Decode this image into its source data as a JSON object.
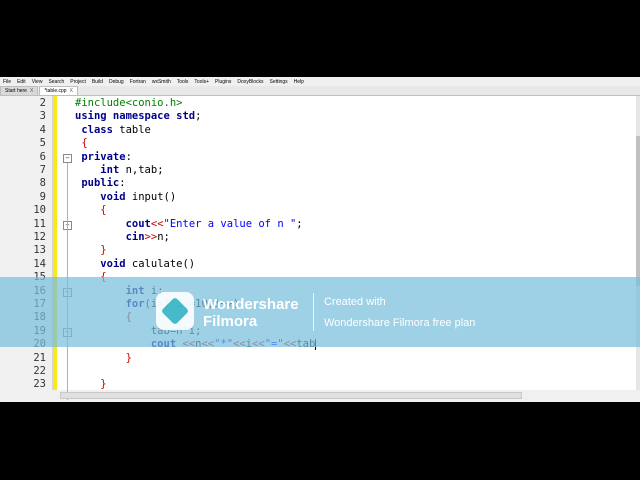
{
  "menubar": [
    "File",
    "Edit",
    "View",
    "Search",
    "Project",
    "Build",
    "Debug",
    "Fortran",
    "wxSmith",
    "Tools",
    "Tools+",
    "Plugins",
    "DoxyBlocks",
    "Settings",
    "Help"
  ],
  "tabs": [
    {
      "label": "Start here",
      "close": "X",
      "active": false
    },
    {
      "label": "*table.cpp",
      "close": "X",
      "active": true
    }
  ],
  "lines": [
    {
      "num": "2",
      "html": "<span class='pp'>#include&lt;conio.h&gt;</span>"
    },
    {
      "num": "3",
      "html": "<span class='kw'>using namespace std</span>;"
    },
    {
      "num": "4",
      "html": " <span class='kw'>class</span> table"
    },
    {
      "num": "5",
      "html": " <span class='op'>{</span>"
    },
    {
      "num": "6",
      "html": " <span class='kw'>private</span>:"
    },
    {
      "num": "7",
      "html": "    <span class='kw'>int</span> n,tab;"
    },
    {
      "num": "8",
      "html": " <span class='kw'>public</span>:"
    },
    {
      "num": "9",
      "html": "    <span class='kw'>void</span> input()"
    },
    {
      "num": "10",
      "html": "    <span class='op'>{</span>"
    },
    {
      "num": "11",
      "html": "        <span class='kw'>cout</span><span class='op'>&lt;&lt;</span><span class='str'>\"Enter a value of n \"</span>;"
    },
    {
      "num": "12",
      "html": "        <span class='kw'>cin</span><span class='op'>&gt;&gt;</span>n;"
    },
    {
      "num": "13",
      "html": "    <span class='op'>}</span>"
    },
    {
      "num": "14",
      "html": "    <span class='kw'>void</span> calulate()"
    },
    {
      "num": "15",
      "html": "    <span class='op'>{</span>"
    },
    {
      "num": "16",
      "html": "        <span class='kw'>int</span> i;"
    },
    {
      "num": "17",
      "html": "        <span class='kw'>for</span>(i=1;i&lt;=10;i++)"
    },
    {
      "num": "18",
      "html": "        <span class='op'>{</span>"
    },
    {
      "num": "19",
      "html": "            tab=n*i;"
    },
    {
      "num": "20",
      "html": "            <span class='kw'>cout</span> <span class='op'>&lt;&lt;</span>n<span class='op'>&lt;&lt;</span><span class='str'>\"*\"</span><span class='op'>&lt;&lt;</span>i<span class='op'>&lt;&lt;</span><span class='str'>\"=\"</span><span class='op'>&lt;&lt;</span>tab<span class='caret'></span>"
    },
    {
      "num": "21",
      "html": "        <span class='op'>}</span>"
    },
    {
      "num": "22",
      "html": ""
    },
    {
      "num": "23",
      "html": "    <span class='op'>}</span>"
    }
  ],
  "watermark": {
    "brand_line1": "Wondershare",
    "brand_line2": "Filmora",
    "created_line1": "Created with",
    "created_line2": "Wondershare Filmora free plan"
  }
}
